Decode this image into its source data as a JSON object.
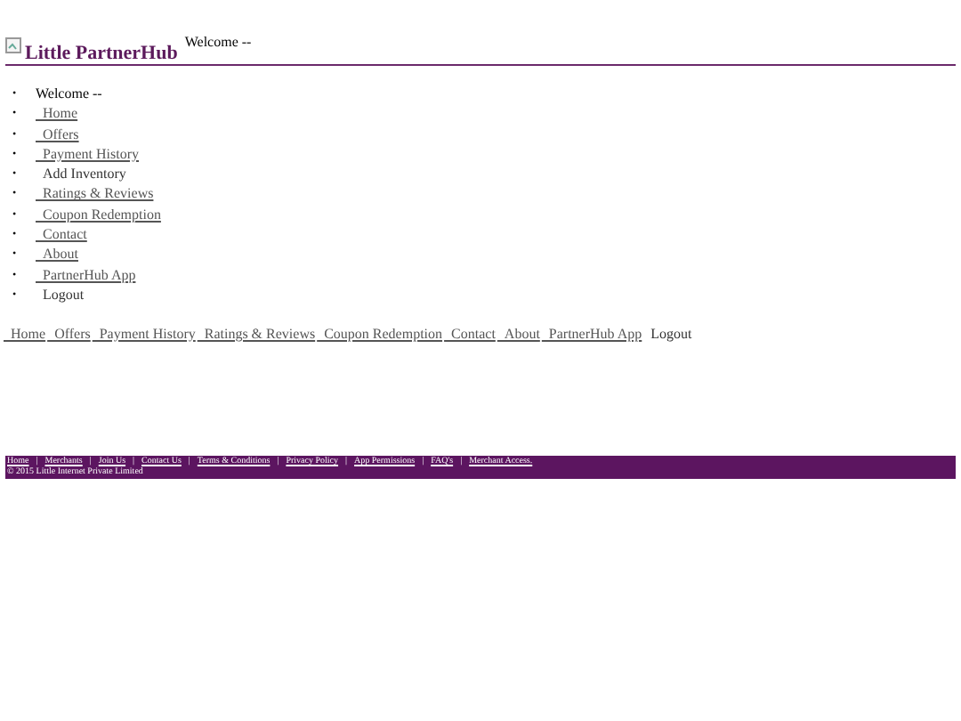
{
  "header": {
    "logo": "Little PartnerHub",
    "welcome": "Welcome --"
  },
  "menu_bullet": "•",
  "menu": [
    {
      "label": "Welcome --",
      "kind": "text"
    },
    {
      "label": "Home",
      "kind": "link"
    },
    {
      "label": "Offers",
      "kind": "link"
    },
    {
      "label": "Payment History",
      "kind": "link"
    },
    {
      "label": "Add Inventory",
      "kind": "text"
    },
    {
      "label": "Ratings & Reviews",
      "kind": "link"
    },
    {
      "label": "Coupon Redemption",
      "kind": "link"
    },
    {
      "label": "Contact",
      "kind": "link"
    },
    {
      "label": "About",
      "kind": "link"
    },
    {
      "label": "PartnerHub App",
      "kind": "link"
    },
    {
      "label": "Logout",
      "kind": "text"
    }
  ],
  "nav": [
    {
      "label": "Home",
      "kind": "link"
    },
    {
      "label": "Offers",
      "kind": "link"
    },
    {
      "label": "Payment History",
      "kind": "link"
    },
    {
      "label": "Ratings & Reviews",
      "kind": "link"
    },
    {
      "label": "Coupon Redemption",
      "kind": "link"
    },
    {
      "label": "Contact",
      "kind": "link"
    },
    {
      "label": "About",
      "kind": "link"
    },
    {
      "label": "PartnerHub App",
      "kind": "link"
    },
    {
      "label": "Logout",
      "kind": "text"
    }
  ],
  "footer": {
    "separator": "|",
    "links": [
      "Home",
      "Merchants",
      "Join Us",
      "Contact Us",
      "Terms & Conditions",
      "Privacy Policy",
      "App Permissions",
      "FAQ's",
      "Merchant Access."
    ],
    "copyright": "© 2015 Little Internet Private Limited"
  }
}
